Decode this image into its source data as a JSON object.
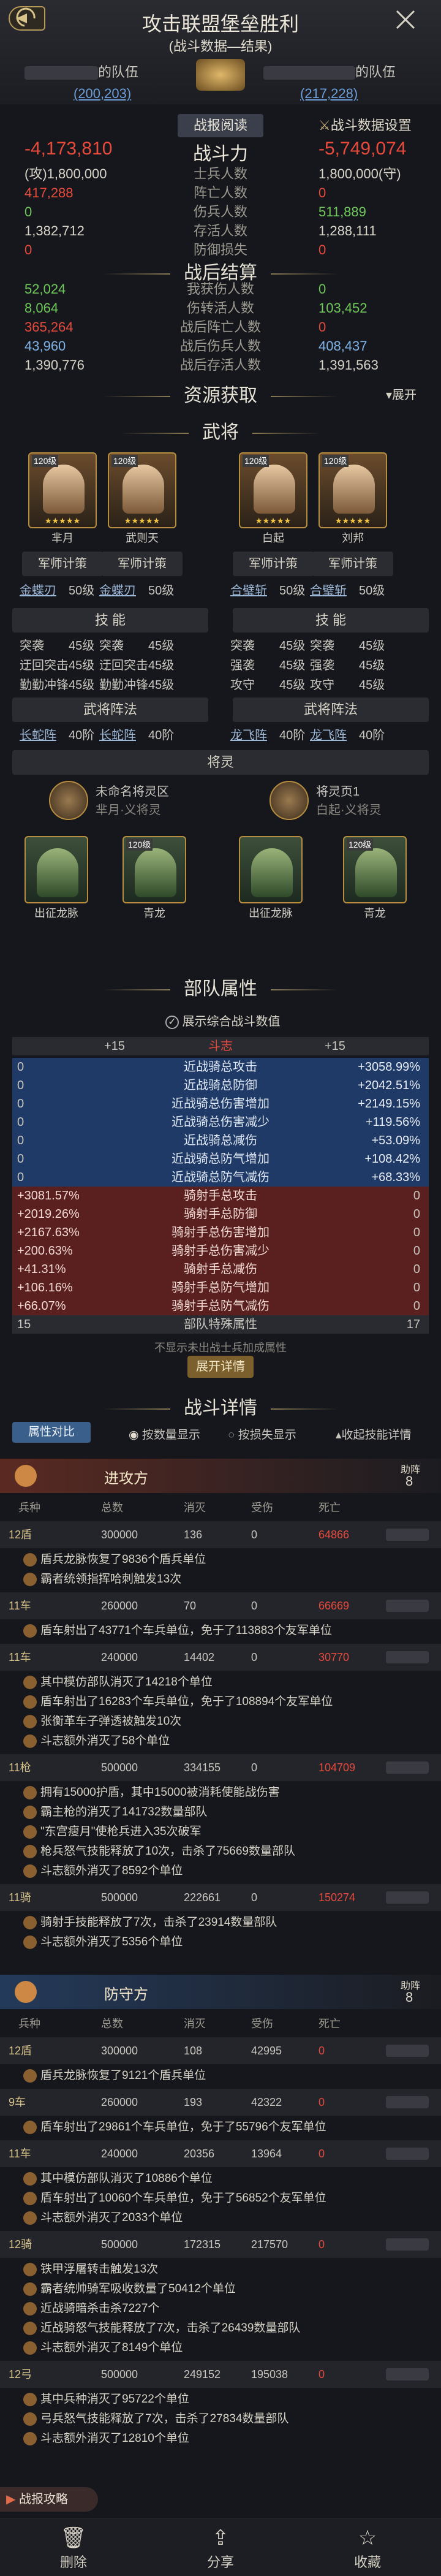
{
  "header": {
    "title": "攻击联盟堡垒胜利",
    "subtitle": "(战斗数据—结果)",
    "left_name": "的队伍",
    "left_coords": "(200,203)",
    "right_name": "的队伍",
    "right_coords": "(217,228)"
  },
  "battle": {
    "tab_report": "战报阅读",
    "tab_settings": "战斗数据设置",
    "power_label": "战斗力",
    "left_power": "-4,173,810",
    "right_power": "-5,749,074",
    "rows": [
      {
        "l": "(攻)1,800,000",
        "m": "士兵人数",
        "r": "1,800,000(守)",
        "lc": "w",
        "rc": "w"
      },
      {
        "l": "417,288",
        "m": "阵亡人数",
        "r": "0",
        "lc": "r",
        "rc": "r"
      },
      {
        "l": "0",
        "m": "伤兵人数",
        "r": "511,889",
        "lc": "g",
        "rc": "g"
      },
      {
        "l": "1,382,712",
        "m": "存活人数",
        "r": "1,288,111",
        "lc": "w",
        "rc": "w"
      },
      {
        "l": "0",
        "m": "防御损失",
        "r": "0",
        "lc": "r",
        "rc": "r"
      }
    ]
  },
  "after": {
    "title": "战后结算",
    "rows": [
      {
        "l": "52,024",
        "m": "我获伤人数",
        "r": "0",
        "lc": "g",
        "rc": "g"
      },
      {
        "l": "8,064",
        "m": "伤转活人数",
        "r": "103,452",
        "lc": "g",
        "rc": "g"
      },
      {
        "l": "365,264",
        "m": "战后阵亡人数",
        "r": "0",
        "lc": "r",
        "rc": "r"
      },
      {
        "l": "43,960",
        "m": "战后伤兵人数",
        "r": "408,437",
        "lc": "b",
        "rc": "b"
      },
      {
        "l": "1,390,776",
        "m": "战后存活人数",
        "r": "1,391,563",
        "lc": "w",
        "rc": "w"
      }
    ]
  },
  "resources": {
    "title": "资源获取",
    "expand": "展开"
  },
  "generals": {
    "title": "武将",
    "cards": [
      {
        "lv": "120级",
        "name": "芈月"
      },
      {
        "lv": "120级",
        "name": "武则天"
      },
      {
        "lv": "120级",
        "name": "白起"
      },
      {
        "lv": "120级",
        "name": "刘邦"
      }
    ],
    "strategy": "军师计策",
    "equip": [
      [
        "金蝶刃",
        "50级"
      ],
      [
        "金蝶刃",
        "50级"
      ],
      [
        "合璧斩",
        "50级"
      ],
      [
        "合璧斩",
        "50级"
      ]
    ],
    "skills_label": "技 能",
    "skill_rows": [
      [
        [
          "突袭",
          "45级"
        ],
        [
          "突袭",
          "45级"
        ],
        [
          "突袭",
          "45级"
        ],
        [
          "突袭",
          "45级"
        ]
      ],
      [
        [
          "迂回突击",
          "45级"
        ],
        [
          "迂回突击",
          "45级"
        ],
        [
          "强袭",
          "45级"
        ],
        [
          "强袭",
          "45级"
        ]
      ],
      [
        [
          "勤勤冲锋",
          "45级"
        ],
        [
          "勤勤冲锋",
          "45级"
        ],
        [
          "攻守",
          "45级"
        ],
        [
          "攻守",
          "45级"
        ]
      ]
    ],
    "formation": "武将阵法",
    "formation_rows": [
      [
        "长蛇阵",
        "40阶"
      ],
      [
        "长蛇阵",
        "40阶"
      ],
      [
        "龙飞阵",
        "40阶"
      ],
      [
        "龙飞阵",
        "40阶"
      ]
    ],
    "spirit_label": "将灵",
    "left_spirit": "未命名将灵区",
    "left_spirit_sub": "芈月·义将灵",
    "right_spirit": "将灵页1",
    "right_spirit_sub": "白起·义将灵",
    "dragons": [
      {
        "lv": "",
        "name": "出征龙脉"
      },
      {
        "lv": "120级",
        "name": "青龙"
      },
      {
        "lv": "",
        "name": "出征龙脉"
      },
      {
        "lv": "120级",
        "name": "青龙"
      }
    ]
  },
  "attrs": {
    "title": "部队属性",
    "show_label": "展示综合战斗数值",
    "head": {
      "l": "+15",
      "m": "斗志",
      "r": "+15"
    },
    "blue_rows": [
      {
        "l": "0",
        "m": "近战骑总攻击",
        "r": "+3058.99%"
      },
      {
        "l": "0",
        "m": "近战骑总防御",
        "r": "+2042.51%"
      },
      {
        "l": "0",
        "m": "近战骑总伤害增加",
        "r": "+2149.15%"
      },
      {
        "l": "0",
        "m": "近战骑总伤害减少",
        "r": "+119.56%"
      },
      {
        "l": "0",
        "m": "近战骑总减伤",
        "r": "+53.09%"
      },
      {
        "l": "0",
        "m": "近战骑总防气增加",
        "r": "+108.42%"
      },
      {
        "l": "0",
        "m": "近战骑总防气减伤",
        "r": "+68.33%"
      }
    ],
    "red_rows": [
      {
        "l": "+3081.57%",
        "m": "骑射手总攻击",
        "r": "0"
      },
      {
        "l": "+2019.26%",
        "m": "骑射手总防御",
        "r": "0"
      },
      {
        "l": "+2167.63%",
        "m": "骑射手总伤害增加",
        "r": "0"
      },
      {
        "l": "+200.63%",
        "m": "骑射手总伤害减少",
        "r": "0"
      },
      {
        "l": "+41.31%",
        "m": "骑射手总减伤",
        "r": "0"
      },
      {
        "l": "+106.16%",
        "m": "骑射手总防气增加",
        "r": "0"
      },
      {
        "l": "+66.07%",
        "m": "骑射手总防气减伤",
        "r": "0"
      }
    ],
    "special": {
      "l": "15",
      "m": "部队特殊属性",
      "r": "17"
    },
    "note": "不显示未出战士兵加成属性",
    "expand": "展开详情"
  },
  "details": {
    "title": "战斗详情",
    "compare": "属性对比",
    "by_num": "按数量显示",
    "by_loss": "按损失显示",
    "collapse": "收起技能详情",
    "attacker": "进攻方",
    "defender": "防守方",
    "rank_label": "助阵",
    "rank": "8",
    "cols": [
      "兵种",
      "总数",
      "消灭",
      "受伤",
      "死亡"
    ],
    "att_rows": [
      {
        "t": "12盾",
        "total": "300000",
        "kill": "136",
        "hurt": "0",
        "dead": "64866",
        "logs": [
          "盾兵龙脉恢复了9836个盾兵单位",
          "霸者统领指挥哈刺触发13次"
        ]
      },
      {
        "t": "11车",
        "total": "260000",
        "kill": "70",
        "hurt": "0",
        "dead": "66669",
        "logs": [
          "盾车射出了43771个车兵单位，免于了113883个友军单位"
        ]
      },
      {
        "t": "11车",
        "total": "240000",
        "kill": "14402",
        "hurt": "0",
        "dead": "30770",
        "logs": [
          "其中模仿部队消灭了14218个单位",
          "盾车射出了16283个车兵单位，免于了108894个友军单位",
          "张衡革车子弹透被触发10次",
          "斗志额外消灭了58个单位"
        ]
      },
      {
        "t": "11枪",
        "total": "500000",
        "kill": "334155",
        "hurt": "0",
        "dead": "104709",
        "logs": [
          "拥有15000护盾，其中15000被消耗使能战伤害",
          "霸主枪的消灭了141732数量部队",
          "\"东宫瘦月\"使枪兵进入35次破军",
          "枪兵怒气技能释放了10次，击杀了75669数量部队",
          "斗志额外消灭了8592个单位"
        ]
      },
      {
        "t": "11骑",
        "total": "500000",
        "kill": "222661",
        "hurt": "0",
        "dead": "150274",
        "logs": [
          "骑射手技能释放了7次，击杀了23914数量部队",
          "斗志额外消灭了5356个单位"
        ]
      }
    ],
    "def_rows": [
      {
        "t": "12盾",
        "total": "300000",
        "kill": "108",
        "hurt": "42995",
        "dead": "0",
        "logs": [
          "盾兵龙脉恢复了9121个盾兵单位"
        ]
      },
      {
        "t": "9车",
        "total": "260000",
        "kill": "193",
        "hurt": "42322",
        "dead": "0",
        "logs": [
          "盾车射出了29861个车兵单位，免于了55796个友军单位"
        ]
      },
      {
        "t": "11车",
        "total": "240000",
        "kill": "20356",
        "hurt": "13964",
        "dead": "0",
        "logs": [
          "其中模仿部队消灭了10886个单位",
          "盾车射出了10060个车兵单位，免于了56852个友军单位",
          "斗志额外消灭了2033个单位"
        ]
      },
      {
        "t": "12骑",
        "total": "500000",
        "kill": "172315",
        "hurt": "217570",
        "dead": "0",
        "logs": [
          "铁甲浮屠转击触发13次",
          "霸者统帅骑军吸收数量了50412个单位",
          "近战骑暗杀击杀7227个",
          "近战骑怒气技能释放了7次，击杀了26439数量部队",
          "斗志额外消灭了8149个单位"
        ]
      },
      {
        "t": "12弓",
        "total": "500000",
        "kill": "249152",
        "hurt": "195038",
        "dead": "0",
        "logs": [
          "其中兵种消灭了95722个单位",
          "弓兵怒气技能释放了7次，击杀了27834数量部队",
          "斗志额外消灭了12810个单位"
        ]
      }
    ]
  },
  "footer": {
    "guide": "战报攻略",
    "delete": "删除",
    "share": "分享",
    "favorite": "收藏"
  }
}
